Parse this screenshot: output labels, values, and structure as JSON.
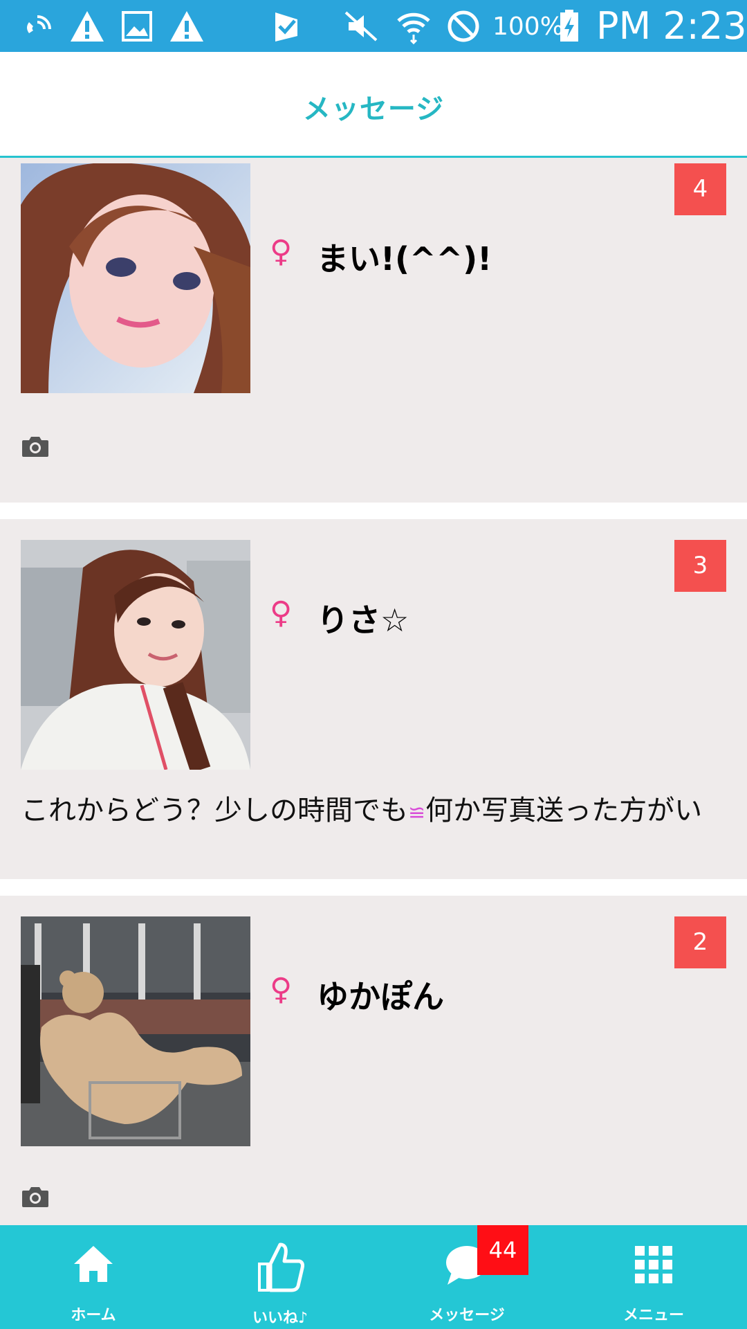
{
  "status_bar": {
    "battery": "100%",
    "time": "PM 2:23",
    "icons": [
      "wifi-calling-icon",
      "warning-icon",
      "image-icon",
      "warning-icon",
      "check-icon",
      "mute-icon",
      "wifi-icon",
      "do-not-disturb-icon",
      "battery-charging-icon"
    ]
  },
  "header": {
    "title": "メッセージ"
  },
  "conversations": [
    {
      "name": "まい!(^^)!",
      "gender": "♀",
      "unread": "4",
      "preview": "",
      "has_photo": true
    },
    {
      "name": "りさ☆",
      "gender": "♀",
      "unread": "3",
      "preview_before": "これからどう？少しの時間でも",
      "preview_emoji": "≌",
      "preview_after": "何か写真送った方がい",
      "has_photo": false
    },
    {
      "name": "ゆかぽん",
      "gender": "♀",
      "unread": "2",
      "preview": "",
      "has_photo": true
    }
  ],
  "bottom_nav": {
    "home": "ホーム",
    "like": "いいね♪",
    "message": "メッセージ",
    "menu": "メニュー",
    "message_badge": "44"
  },
  "colors": {
    "status_bar": "#2aa5dc",
    "accent": "#26c3cf",
    "badge": "#f4504f",
    "nav_badge": "#ff0e15",
    "gender": "#ec3b87",
    "card_bg": "#efebeb"
  }
}
